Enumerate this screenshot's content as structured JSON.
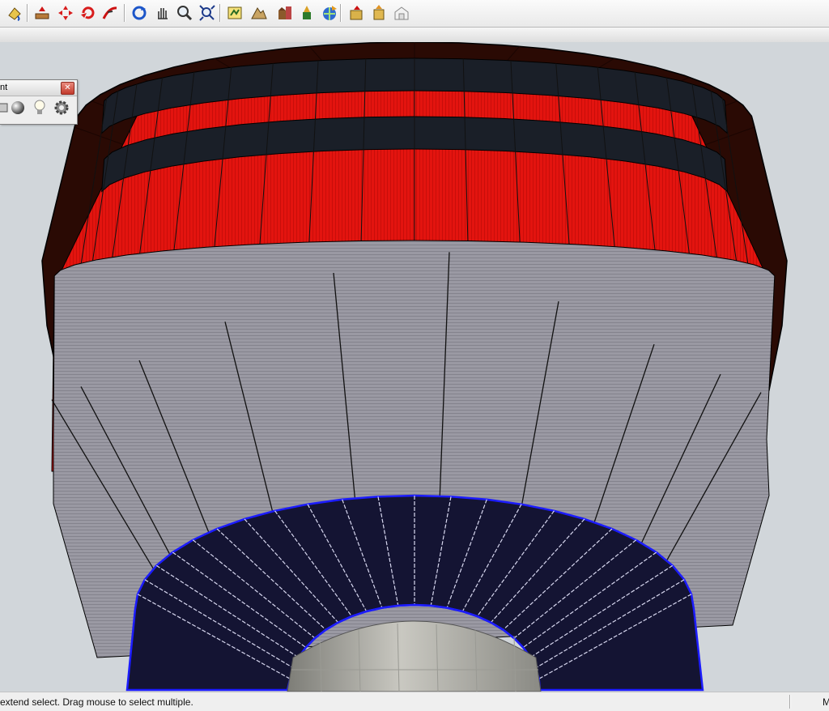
{
  "toolbar": {
    "buttons": [
      {
        "name": "paint-bucket-icon"
      },
      {
        "name": "push-pull-icon"
      },
      {
        "name": "move-icon"
      },
      {
        "name": "rotate-icon"
      },
      {
        "name": "follow-me-icon"
      },
      {
        "name": "orbit-icon"
      },
      {
        "name": "pan-icon"
      },
      {
        "name": "zoom-icon"
      },
      {
        "name": "zoom-extents-icon"
      },
      {
        "name": "add-location-icon"
      },
      {
        "name": "toggle-terrain-icon"
      },
      {
        "name": "photo-textures-icon"
      },
      {
        "name": "preview-model-in-google-earth-icon"
      },
      {
        "name": "get-models-icon"
      },
      {
        "name": "share-model-icon"
      },
      {
        "name": "share-component-icon"
      },
      {
        "name": "extension-warehouse-icon"
      }
    ]
  },
  "panel": {
    "title_fragment": "nt",
    "close_glyph": "✕",
    "tools": [
      {
        "name": "shape-tool-icon"
      },
      {
        "name": "sphere-material-icon"
      },
      {
        "name": "light-bulb-icon"
      },
      {
        "name": "settings-gear-icon"
      }
    ]
  },
  "status": {
    "text": "extend select. Drag mouse to select multiple.",
    "right_text": "M"
  },
  "colors": {
    "roof": "#2a0a04",
    "red_band": "#e0100c",
    "dark_band": "#1a1f28",
    "grey_panel": "#8c8b95",
    "bottom_ring": "#141433",
    "selection": "#1c1cff",
    "concrete": "#b5b5ae",
    "sky": "#d1d6da"
  }
}
